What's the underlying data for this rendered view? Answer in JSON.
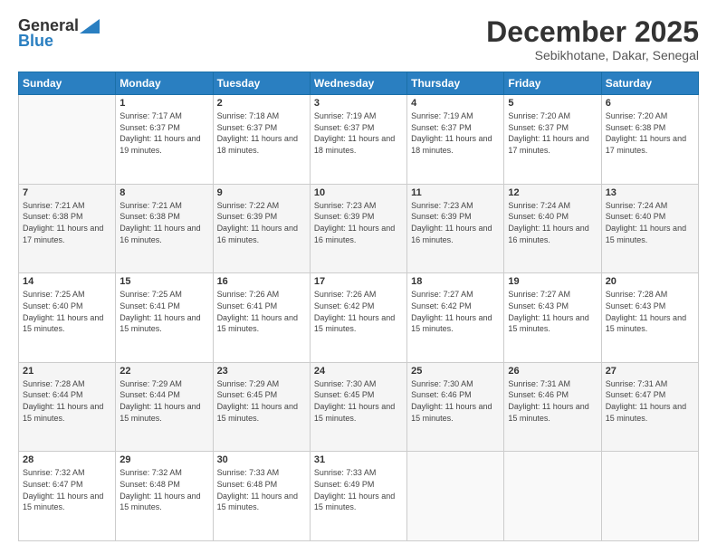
{
  "header": {
    "logo_general": "General",
    "logo_blue": "Blue",
    "month_title": "December 2025",
    "location": "Sebikhotane, Dakar, Senegal"
  },
  "days_of_week": [
    "Sunday",
    "Monday",
    "Tuesday",
    "Wednesday",
    "Thursday",
    "Friday",
    "Saturday"
  ],
  "weeks": [
    [
      {
        "num": "",
        "sunrise": "",
        "sunset": "",
        "daylight": ""
      },
      {
        "num": "1",
        "sunrise": "Sunrise: 7:17 AM",
        "sunset": "Sunset: 6:37 PM",
        "daylight": "Daylight: 11 hours and 19 minutes."
      },
      {
        "num": "2",
        "sunrise": "Sunrise: 7:18 AM",
        "sunset": "Sunset: 6:37 PM",
        "daylight": "Daylight: 11 hours and 18 minutes."
      },
      {
        "num": "3",
        "sunrise": "Sunrise: 7:19 AM",
        "sunset": "Sunset: 6:37 PM",
        "daylight": "Daylight: 11 hours and 18 minutes."
      },
      {
        "num": "4",
        "sunrise": "Sunrise: 7:19 AM",
        "sunset": "Sunset: 6:37 PM",
        "daylight": "Daylight: 11 hours and 18 minutes."
      },
      {
        "num": "5",
        "sunrise": "Sunrise: 7:20 AM",
        "sunset": "Sunset: 6:37 PM",
        "daylight": "Daylight: 11 hours and 17 minutes."
      },
      {
        "num": "6",
        "sunrise": "Sunrise: 7:20 AM",
        "sunset": "Sunset: 6:38 PM",
        "daylight": "Daylight: 11 hours and 17 minutes."
      }
    ],
    [
      {
        "num": "7",
        "sunrise": "Sunrise: 7:21 AM",
        "sunset": "Sunset: 6:38 PM",
        "daylight": "Daylight: 11 hours and 17 minutes."
      },
      {
        "num": "8",
        "sunrise": "Sunrise: 7:21 AM",
        "sunset": "Sunset: 6:38 PM",
        "daylight": "Daylight: 11 hours and 16 minutes."
      },
      {
        "num": "9",
        "sunrise": "Sunrise: 7:22 AM",
        "sunset": "Sunset: 6:39 PM",
        "daylight": "Daylight: 11 hours and 16 minutes."
      },
      {
        "num": "10",
        "sunrise": "Sunrise: 7:23 AM",
        "sunset": "Sunset: 6:39 PM",
        "daylight": "Daylight: 11 hours and 16 minutes."
      },
      {
        "num": "11",
        "sunrise": "Sunrise: 7:23 AM",
        "sunset": "Sunset: 6:39 PM",
        "daylight": "Daylight: 11 hours and 16 minutes."
      },
      {
        "num": "12",
        "sunrise": "Sunrise: 7:24 AM",
        "sunset": "Sunset: 6:40 PM",
        "daylight": "Daylight: 11 hours and 16 minutes."
      },
      {
        "num": "13",
        "sunrise": "Sunrise: 7:24 AM",
        "sunset": "Sunset: 6:40 PM",
        "daylight": "Daylight: 11 hours and 15 minutes."
      }
    ],
    [
      {
        "num": "14",
        "sunrise": "Sunrise: 7:25 AM",
        "sunset": "Sunset: 6:40 PM",
        "daylight": "Daylight: 11 hours and 15 minutes."
      },
      {
        "num": "15",
        "sunrise": "Sunrise: 7:25 AM",
        "sunset": "Sunset: 6:41 PM",
        "daylight": "Daylight: 11 hours and 15 minutes."
      },
      {
        "num": "16",
        "sunrise": "Sunrise: 7:26 AM",
        "sunset": "Sunset: 6:41 PM",
        "daylight": "Daylight: 11 hours and 15 minutes."
      },
      {
        "num": "17",
        "sunrise": "Sunrise: 7:26 AM",
        "sunset": "Sunset: 6:42 PM",
        "daylight": "Daylight: 11 hours and 15 minutes."
      },
      {
        "num": "18",
        "sunrise": "Sunrise: 7:27 AM",
        "sunset": "Sunset: 6:42 PM",
        "daylight": "Daylight: 11 hours and 15 minutes."
      },
      {
        "num": "19",
        "sunrise": "Sunrise: 7:27 AM",
        "sunset": "Sunset: 6:43 PM",
        "daylight": "Daylight: 11 hours and 15 minutes."
      },
      {
        "num": "20",
        "sunrise": "Sunrise: 7:28 AM",
        "sunset": "Sunset: 6:43 PM",
        "daylight": "Daylight: 11 hours and 15 minutes."
      }
    ],
    [
      {
        "num": "21",
        "sunrise": "Sunrise: 7:28 AM",
        "sunset": "Sunset: 6:44 PM",
        "daylight": "Daylight: 11 hours and 15 minutes."
      },
      {
        "num": "22",
        "sunrise": "Sunrise: 7:29 AM",
        "sunset": "Sunset: 6:44 PM",
        "daylight": "Daylight: 11 hours and 15 minutes."
      },
      {
        "num": "23",
        "sunrise": "Sunrise: 7:29 AM",
        "sunset": "Sunset: 6:45 PM",
        "daylight": "Daylight: 11 hours and 15 minutes."
      },
      {
        "num": "24",
        "sunrise": "Sunrise: 7:30 AM",
        "sunset": "Sunset: 6:45 PM",
        "daylight": "Daylight: 11 hours and 15 minutes."
      },
      {
        "num": "25",
        "sunrise": "Sunrise: 7:30 AM",
        "sunset": "Sunset: 6:46 PM",
        "daylight": "Daylight: 11 hours and 15 minutes."
      },
      {
        "num": "26",
        "sunrise": "Sunrise: 7:31 AM",
        "sunset": "Sunset: 6:46 PM",
        "daylight": "Daylight: 11 hours and 15 minutes."
      },
      {
        "num": "27",
        "sunrise": "Sunrise: 7:31 AM",
        "sunset": "Sunset: 6:47 PM",
        "daylight": "Daylight: 11 hours and 15 minutes."
      }
    ],
    [
      {
        "num": "28",
        "sunrise": "Sunrise: 7:32 AM",
        "sunset": "Sunset: 6:47 PM",
        "daylight": "Daylight: 11 hours and 15 minutes."
      },
      {
        "num": "29",
        "sunrise": "Sunrise: 7:32 AM",
        "sunset": "Sunset: 6:48 PM",
        "daylight": "Daylight: 11 hours and 15 minutes."
      },
      {
        "num": "30",
        "sunrise": "Sunrise: 7:33 AM",
        "sunset": "Sunset: 6:48 PM",
        "daylight": "Daylight: 11 hours and 15 minutes."
      },
      {
        "num": "31",
        "sunrise": "Sunrise: 7:33 AM",
        "sunset": "Sunset: 6:49 PM",
        "daylight": "Daylight: 11 hours and 15 minutes."
      },
      {
        "num": "",
        "sunrise": "",
        "sunset": "",
        "daylight": ""
      },
      {
        "num": "",
        "sunrise": "",
        "sunset": "",
        "daylight": ""
      },
      {
        "num": "",
        "sunrise": "",
        "sunset": "",
        "daylight": ""
      }
    ]
  ]
}
